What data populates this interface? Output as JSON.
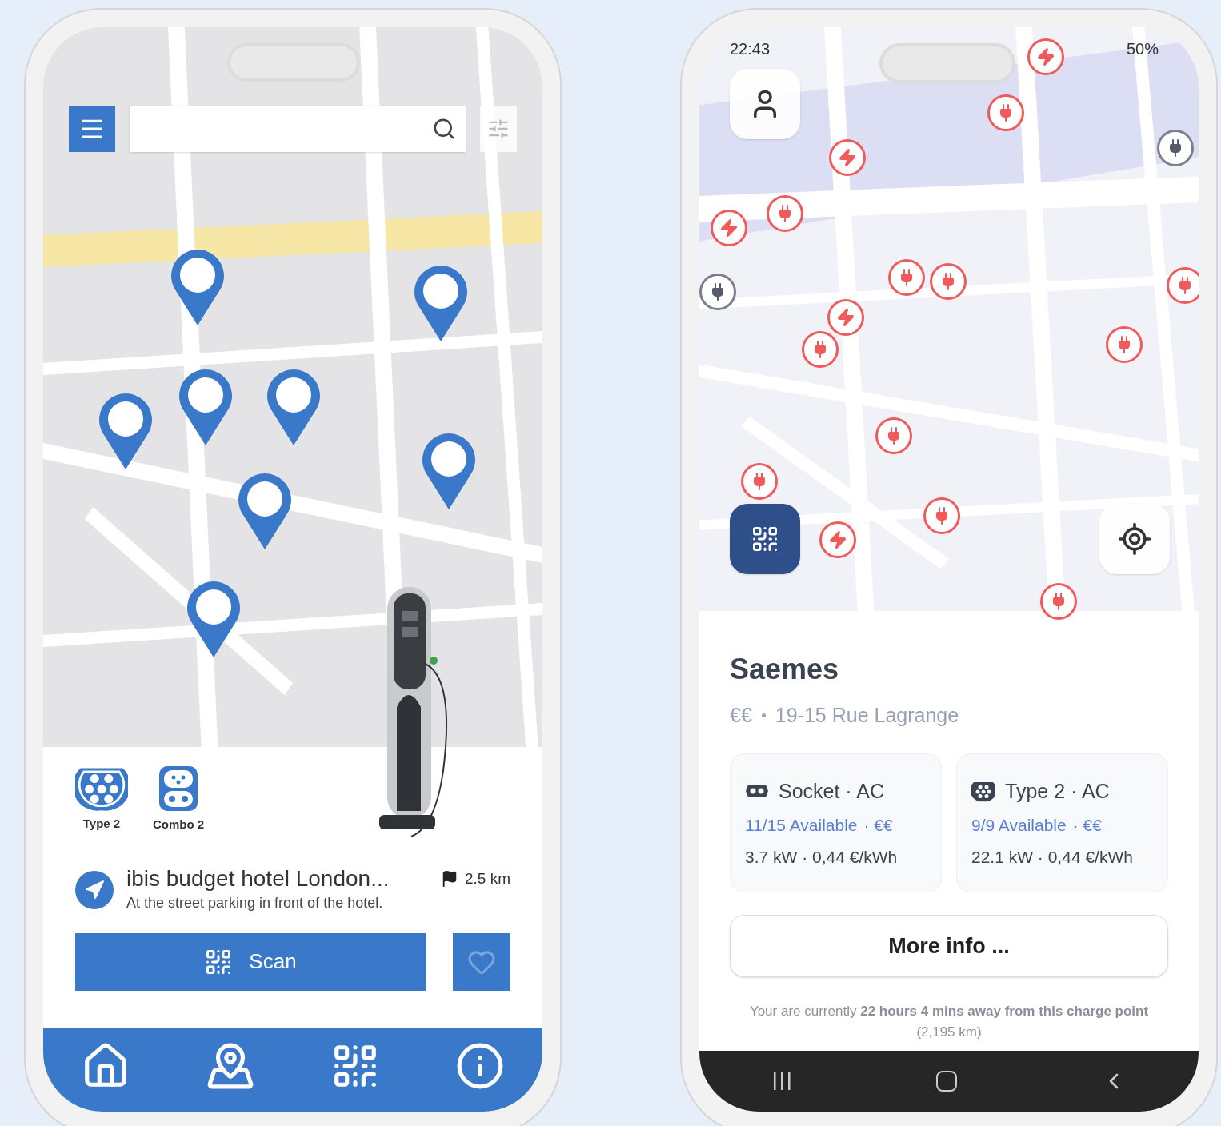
{
  "left_phone": {
    "connectors": [
      {
        "kind": "type2",
        "label": "Type 2"
      },
      {
        "kind": "combo2",
        "label": "Combo 2"
      }
    ],
    "station": {
      "name": "ibis budget hotel London...",
      "description": "At the street parking in front of the hotel.",
      "distance": "2.5 km"
    },
    "scan_button": "Scan"
  },
  "right_phone": {
    "status_bar": {
      "time": "22:43",
      "battery": "50%"
    },
    "station": {
      "name": "Saemes",
      "price": "€€",
      "address": "19-15 Rue Lagrange"
    },
    "connectors": [
      {
        "kind": "socket",
        "title": "Socket · AC",
        "availability": "11/15 Available",
        "price": "· €€",
        "power": "3.7 kW · 0,44 €/kWh"
      },
      {
        "kind": "type2",
        "title": "Type 2 · AC",
        "availability": "9/9 Available",
        "price": "· €€",
        "power": "22.1 kW · 0,44 €/kWh"
      }
    ],
    "more_info_button": "More info ...",
    "travel_note": "Your are currently **22 hours 4 mins away from this charge point** (2,195 km)"
  }
}
